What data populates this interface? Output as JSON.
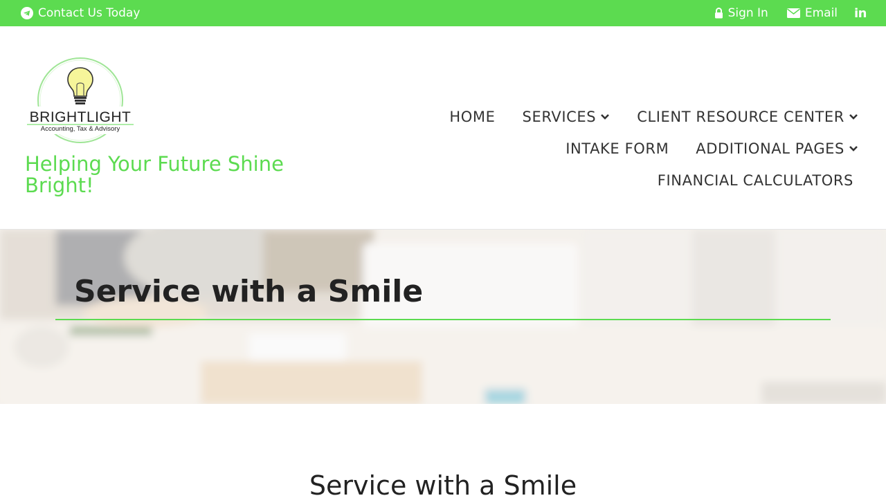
{
  "topbar": {
    "contact_label": "Contact Us Today",
    "signin_label": "Sign In",
    "email_label": "Email",
    "linkedin_label": "in"
  },
  "logo": {
    "name": "BRIGHTLIGHT",
    "subtitle": "Accounting, Tax & Advisory"
  },
  "tagline": "Helping Your Future Shine Bright!",
  "nav": {
    "home": "HOME",
    "services": "SERVICES",
    "client_resource_center": "CLIENT RESOURCE CENTER",
    "intake_form": "INTAKE FORM",
    "additional_pages": "ADDITIONAL PAGES",
    "financial_calculators": "FINANCIAL CALCULATORS"
  },
  "hero": {
    "title": "Service with a Smile"
  },
  "section": {
    "title": "Service with a Smile"
  },
  "colors": {
    "accent": "#5cdb50",
    "text_dark": "#222222",
    "nav_text": "#333333"
  },
  "icons": [
    "telegram-icon",
    "lock-icon",
    "envelope-icon",
    "linkedin-icon",
    "chevron-down-icon",
    "lightbulb-icon"
  ]
}
